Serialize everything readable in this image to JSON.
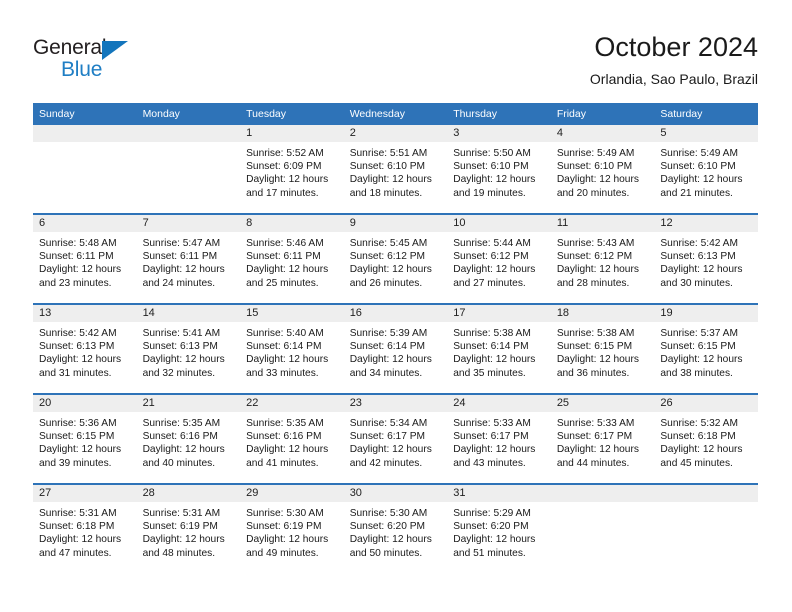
{
  "brand": {
    "name_part1": "General",
    "name_part2": "Blue",
    "accent_color": "#1f7ec4",
    "triangle_color": "#1375bc"
  },
  "header": {
    "title": "October 2024",
    "subtitle": "Orlandia, Sao Paulo, Brazil",
    "header_bg_color": "#2e73b8"
  },
  "weekday_headers": [
    "Sunday",
    "Monday",
    "Tuesday",
    "Wednesday",
    "Thursday",
    "Friday",
    "Saturday"
  ],
  "labels": {
    "sunrise_prefix": "Sunrise:",
    "sunset_prefix": "Sunset:",
    "daylight_prefix": "Daylight:"
  },
  "weeks": [
    [
      {
        "day": "",
        "empty": true
      },
      {
        "day": "",
        "empty": true
      },
      {
        "day": "1",
        "sunrise": "Sunrise: 5:52 AM",
        "sunset": "Sunset: 6:09 PM",
        "daylight_l1": "Daylight: 12 hours",
        "daylight_l2": "and 17 minutes."
      },
      {
        "day": "2",
        "sunrise": "Sunrise: 5:51 AM",
        "sunset": "Sunset: 6:10 PM",
        "daylight_l1": "Daylight: 12 hours",
        "daylight_l2": "and 18 minutes."
      },
      {
        "day": "3",
        "sunrise": "Sunrise: 5:50 AM",
        "sunset": "Sunset: 6:10 PM",
        "daylight_l1": "Daylight: 12 hours",
        "daylight_l2": "and 19 minutes."
      },
      {
        "day": "4",
        "sunrise": "Sunrise: 5:49 AM",
        "sunset": "Sunset: 6:10 PM",
        "daylight_l1": "Daylight: 12 hours",
        "daylight_l2": "and 20 minutes."
      },
      {
        "day": "5",
        "sunrise": "Sunrise: 5:49 AM",
        "sunset": "Sunset: 6:10 PM",
        "daylight_l1": "Daylight: 12 hours",
        "daylight_l2": "and 21 minutes."
      }
    ],
    [
      {
        "day": "6",
        "sunrise": "Sunrise: 5:48 AM",
        "sunset": "Sunset: 6:11 PM",
        "daylight_l1": "Daylight: 12 hours",
        "daylight_l2": "and 23 minutes."
      },
      {
        "day": "7",
        "sunrise": "Sunrise: 5:47 AM",
        "sunset": "Sunset: 6:11 PM",
        "daylight_l1": "Daylight: 12 hours",
        "daylight_l2": "and 24 minutes."
      },
      {
        "day": "8",
        "sunrise": "Sunrise: 5:46 AM",
        "sunset": "Sunset: 6:11 PM",
        "daylight_l1": "Daylight: 12 hours",
        "daylight_l2": "and 25 minutes."
      },
      {
        "day": "9",
        "sunrise": "Sunrise: 5:45 AM",
        "sunset": "Sunset: 6:12 PM",
        "daylight_l1": "Daylight: 12 hours",
        "daylight_l2": "and 26 minutes."
      },
      {
        "day": "10",
        "sunrise": "Sunrise: 5:44 AM",
        "sunset": "Sunset: 6:12 PM",
        "daylight_l1": "Daylight: 12 hours",
        "daylight_l2": "and 27 minutes."
      },
      {
        "day": "11",
        "sunrise": "Sunrise: 5:43 AM",
        "sunset": "Sunset: 6:12 PM",
        "daylight_l1": "Daylight: 12 hours",
        "daylight_l2": "and 28 minutes."
      },
      {
        "day": "12",
        "sunrise": "Sunrise: 5:42 AM",
        "sunset": "Sunset: 6:13 PM",
        "daylight_l1": "Daylight: 12 hours",
        "daylight_l2": "and 30 minutes."
      }
    ],
    [
      {
        "day": "13",
        "sunrise": "Sunrise: 5:42 AM",
        "sunset": "Sunset: 6:13 PM",
        "daylight_l1": "Daylight: 12 hours",
        "daylight_l2": "and 31 minutes."
      },
      {
        "day": "14",
        "sunrise": "Sunrise: 5:41 AM",
        "sunset": "Sunset: 6:13 PM",
        "daylight_l1": "Daylight: 12 hours",
        "daylight_l2": "and 32 minutes."
      },
      {
        "day": "15",
        "sunrise": "Sunrise: 5:40 AM",
        "sunset": "Sunset: 6:14 PM",
        "daylight_l1": "Daylight: 12 hours",
        "daylight_l2": "and 33 minutes."
      },
      {
        "day": "16",
        "sunrise": "Sunrise: 5:39 AM",
        "sunset": "Sunset: 6:14 PM",
        "daylight_l1": "Daylight: 12 hours",
        "daylight_l2": "and 34 minutes."
      },
      {
        "day": "17",
        "sunrise": "Sunrise: 5:38 AM",
        "sunset": "Sunset: 6:14 PM",
        "daylight_l1": "Daylight: 12 hours",
        "daylight_l2": "and 35 minutes."
      },
      {
        "day": "18",
        "sunrise": "Sunrise: 5:38 AM",
        "sunset": "Sunset: 6:15 PM",
        "daylight_l1": "Daylight: 12 hours",
        "daylight_l2": "and 36 minutes."
      },
      {
        "day": "19",
        "sunrise": "Sunrise: 5:37 AM",
        "sunset": "Sunset: 6:15 PM",
        "daylight_l1": "Daylight: 12 hours",
        "daylight_l2": "and 38 minutes."
      }
    ],
    [
      {
        "day": "20",
        "sunrise": "Sunrise: 5:36 AM",
        "sunset": "Sunset: 6:15 PM",
        "daylight_l1": "Daylight: 12 hours",
        "daylight_l2": "and 39 minutes."
      },
      {
        "day": "21",
        "sunrise": "Sunrise: 5:35 AM",
        "sunset": "Sunset: 6:16 PM",
        "daylight_l1": "Daylight: 12 hours",
        "daylight_l2": "and 40 minutes."
      },
      {
        "day": "22",
        "sunrise": "Sunrise: 5:35 AM",
        "sunset": "Sunset: 6:16 PM",
        "daylight_l1": "Daylight: 12 hours",
        "daylight_l2": "and 41 minutes."
      },
      {
        "day": "23",
        "sunrise": "Sunrise: 5:34 AM",
        "sunset": "Sunset: 6:17 PM",
        "daylight_l1": "Daylight: 12 hours",
        "daylight_l2": "and 42 minutes."
      },
      {
        "day": "24",
        "sunrise": "Sunrise: 5:33 AM",
        "sunset": "Sunset: 6:17 PM",
        "daylight_l1": "Daylight: 12 hours",
        "daylight_l2": "and 43 minutes."
      },
      {
        "day": "25",
        "sunrise": "Sunrise: 5:33 AM",
        "sunset": "Sunset: 6:17 PM",
        "daylight_l1": "Daylight: 12 hours",
        "daylight_l2": "and 44 minutes."
      },
      {
        "day": "26",
        "sunrise": "Sunrise: 5:32 AM",
        "sunset": "Sunset: 6:18 PM",
        "daylight_l1": "Daylight: 12 hours",
        "daylight_l2": "and 45 minutes."
      }
    ],
    [
      {
        "day": "27",
        "sunrise": "Sunrise: 5:31 AM",
        "sunset": "Sunset: 6:18 PM",
        "daylight_l1": "Daylight: 12 hours",
        "daylight_l2": "and 47 minutes."
      },
      {
        "day": "28",
        "sunrise": "Sunrise: 5:31 AM",
        "sunset": "Sunset: 6:19 PM",
        "daylight_l1": "Daylight: 12 hours",
        "daylight_l2": "and 48 minutes."
      },
      {
        "day": "29",
        "sunrise": "Sunrise: 5:30 AM",
        "sunset": "Sunset: 6:19 PM",
        "daylight_l1": "Daylight: 12 hours",
        "daylight_l2": "and 49 minutes."
      },
      {
        "day": "30",
        "sunrise": "Sunrise: 5:30 AM",
        "sunset": "Sunset: 6:20 PM",
        "daylight_l1": "Daylight: 12 hours",
        "daylight_l2": "and 50 minutes."
      },
      {
        "day": "31",
        "sunrise": "Sunrise: 5:29 AM",
        "sunset": "Sunset: 6:20 PM",
        "daylight_l1": "Daylight: 12 hours",
        "daylight_l2": "and 51 minutes."
      },
      {
        "day": "",
        "empty": true
      },
      {
        "day": "",
        "empty": true
      }
    ]
  ]
}
